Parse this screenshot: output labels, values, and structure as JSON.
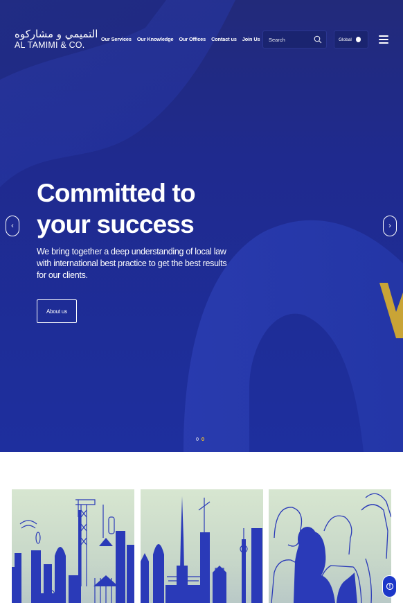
{
  "header": {
    "logo_arabic": "التميمي و مشاركوه",
    "logo_english": "AL TAMIMI & CO.",
    "nav": [
      "Our Services",
      "Our Knowledge",
      "Our Offices",
      "Contact us",
      "Join Us"
    ],
    "search_placeholder": "Search",
    "region_label": "Global"
  },
  "hero": {
    "title_line1": "Committed to",
    "title_line2": "your success",
    "subtitle": "We bring together a deep understanding of local law with international best practice to get the best results for our clients.",
    "cta_label": "About us",
    "prev_arrow": "‹",
    "next_arrow": "›",
    "slide_count": 2,
    "active_slide": 2
  },
  "cards": [
    {
      "illustration": "construction-city-illustration"
    },
    {
      "illustration": "skyline-illustration"
    },
    {
      "illustration": "people-illustration"
    }
  ],
  "colors": {
    "hero_blue": "#1f2a8a",
    "accent_gold": "#f4c32b",
    "illustration_blue": "#2a3ab8",
    "a11y_blue": "#1c37c9"
  },
  "icons": {
    "search": "search-icon",
    "globe": "globe-icon",
    "menu": "hamburger-menu-icon",
    "accessibility": "accessibility-icon"
  }
}
